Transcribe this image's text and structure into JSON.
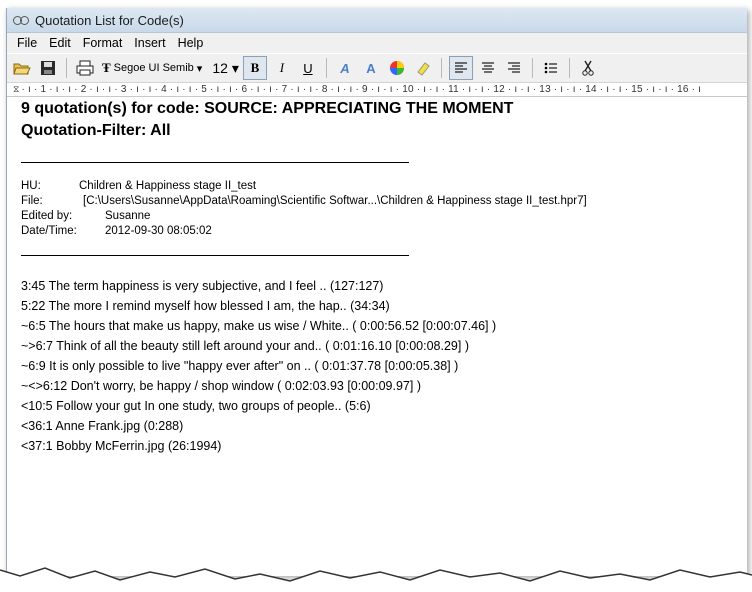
{
  "window": {
    "title": "Quotation List for Code(s)"
  },
  "menu": [
    "File",
    "Edit",
    "Format",
    "Insert",
    "Help"
  ],
  "toolbar": {
    "font_name": "Segoe UI Semib",
    "font_size": "12"
  },
  "ruler": {
    "marks": [
      "1",
      "2",
      "3",
      "4",
      "5",
      "6",
      "7",
      "8",
      "9",
      "10",
      "11",
      "12",
      "13",
      "14",
      "15",
      "16"
    ]
  },
  "document": {
    "heading_line1": "9 quotation(s) for code: SOURCE: APPRECIATING THE MOMENT",
    "heading_line2": "Quotation-Filter: All",
    "meta": {
      "hu_label": "HU:",
      "hu_value": "Children & Happiness stage II_test",
      "file_label": "File:",
      "file_value": "[C:\\Users\\Susanne\\AppData\\Roaming\\Scientific Softwar...\\Children & Happiness stage II_test.hpr7]",
      "edited_label": "Edited by:",
      "edited_value": "Susanne",
      "date_label": "Date/Time:",
      "date_value": "2012-09-30 08:05:02"
    },
    "quotations": [
      "3:45 The term happiness is very subjective, and I feel .. (127:127)",
      "5:22 The more I remind myself how blessed I am, the hap.. (34:34)",
      "~6:5 The hours that make us happy, make us wise / White.. ( 0:00:56.52 [0:00:07.46] )",
      "~>6:7 Think of all the beauty still left around your and.. ( 0:01:16.10 [0:00:08.29] )",
      "~6:9 It is only possible to live \"happy ever after\" on .. ( 0:01:37.78 [0:00:05.38] )",
      "~<>6:12 Don't worry, be happy / shop window ( 0:02:03.93 [0:00:09.97] )",
      "<10:5 Follow your gut In one study, two groups of people.. (5:6)",
      "<36:1 Anne Frank.jpg (0:288)",
      "<37:1 Bobby McFerrin.jpg (26:1994)"
    ]
  }
}
